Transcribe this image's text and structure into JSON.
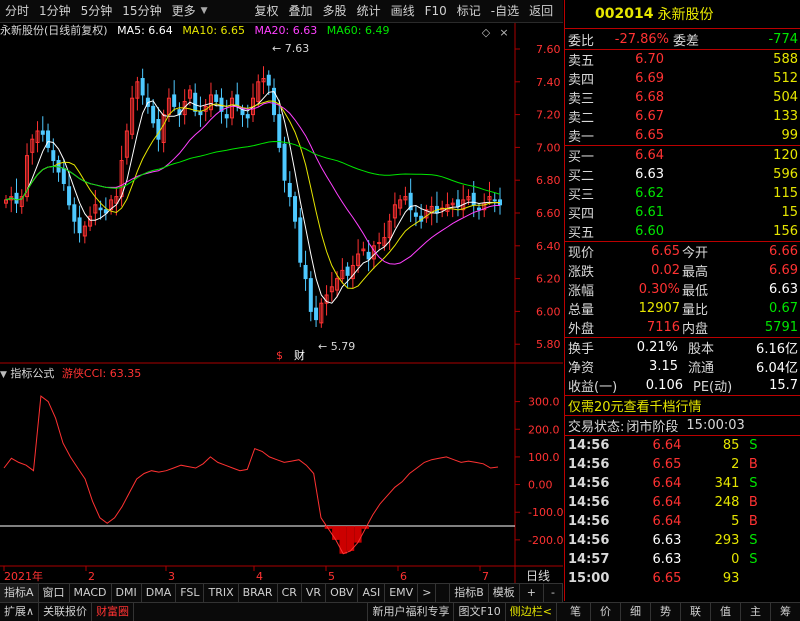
{
  "toolbar": {
    "left_items": [
      "分时",
      "1分钟",
      "5分钟",
      "15分钟",
      "更多"
    ],
    "right_items": [
      "复权",
      "叠加",
      "多股",
      "统计",
      "画线",
      "F10",
      "标记",
      "-自选",
      "返回"
    ]
  },
  "chart": {
    "title": "永新股份(日线前复权)",
    "ma": [
      {
        "label": "MA5: 6.64",
        "color": "#ffffff"
      },
      {
        "label": "MA10: 6.65",
        "color": "#e6e600"
      },
      {
        "label": "MA20: 6.63",
        "color": "#ff40ff"
      },
      {
        "label": "MA60: 6.49",
        "color": "#00e600"
      }
    ],
    "price_ticks": [
      "7.60",
      "7.40",
      "7.20",
      "7.00",
      "6.80",
      "6.60",
      "6.40",
      "6.20",
      "6.00",
      "5.80"
    ],
    "high_label": "7.63",
    "low_label": "5.79",
    "marker_s": "$",
    "marker_cai": "财",
    "x_labels": [
      "2021年",
      "2",
      "3",
      "4",
      "5",
      "6",
      "7"
    ],
    "period_label": "日线"
  },
  "indicator": {
    "title": "指标公式",
    "name": "游侠CCI: 63.35",
    "ticks": [
      "300.0",
      "200.0",
      "100.0",
      "0.00",
      "-100.0",
      "-200.0"
    ]
  },
  "chart_data": {
    "type": "line",
    "title": "游侠CCI",
    "series": [
      {
        "name": "游侠CCI",
        "values": [
          60,
          95,
          80,
          70,
          50,
          320,
          300,
          240,
          150,
          100,
          60,
          20,
          -60,
          -120,
          -140,
          -120,
          -80,
          -30,
          20,
          40,
          50,
          45,
          50,
          60,
          70,
          65,
          60,
          75,
          100,
          80,
          70,
          60,
          50,
          55,
          130,
          120,
          100,
          90,
          80,
          85,
          90,
          70,
          40,
          -120,
          -160,
          -200,
          -250,
          -240,
          -210,
          -160,
          -110,
          -70,
          -40,
          -10,
          10,
          40,
          60,
          80,
          90,
          95,
          100,
          90,
          80,
          85,
          80,
          75,
          60,
          63.35
        ]
      }
    ],
    "ylim": [
      -280,
      360
    ]
  },
  "quote": {
    "code": "002014",
    "name": "永新股份",
    "weibi_label": "委比",
    "weibi": "-27.86%",
    "weicha_label": "委差",
    "weicha": "-774",
    "asks": [
      {
        "label": "卖五",
        "price": "6.70",
        "vol": "588"
      },
      {
        "label": "卖四",
        "price": "6.69",
        "vol": "512"
      },
      {
        "label": "卖三",
        "price": "6.68",
        "vol": "504"
      },
      {
        "label": "卖二",
        "price": "6.67",
        "vol": "133"
      },
      {
        "label": "卖一",
        "price": "6.65",
        "vol": "99"
      }
    ],
    "bids": [
      {
        "label": "买一",
        "price": "6.64",
        "vol": "120",
        "pc": "red"
      },
      {
        "label": "买二",
        "price": "6.63",
        "vol": "596",
        "pc": "wht"
      },
      {
        "label": "买三",
        "price": "6.62",
        "vol": "115",
        "pc": "grn"
      },
      {
        "label": "买四",
        "price": "6.61",
        "vol": "15",
        "pc": "grn"
      },
      {
        "label": "买五",
        "price": "6.60",
        "vol": "156",
        "pc": "grn"
      }
    ],
    "stats": [
      {
        "l1": "现价",
        "v1": "6.65",
        "c1": "red",
        "l2": "今开",
        "v2": "6.66",
        "c2": "red"
      },
      {
        "l1": "涨跌",
        "v1": "0.02",
        "c1": "red",
        "l2": "最高",
        "v2": "6.69",
        "c2": "red"
      },
      {
        "l1": "涨幅",
        "v1": "0.30%",
        "c1": "red",
        "l2": "最低",
        "v2": "6.63",
        "c2": "wht"
      },
      {
        "l1": "总量",
        "v1": "12907",
        "c1": "yel",
        "l2": "量比",
        "v2": "0.67",
        "c2": "grn"
      },
      {
        "l1": "外盘",
        "v1": "7116",
        "c1": "red",
        "l2": "内盘",
        "v2": "5791",
        "c2": "grn"
      }
    ],
    "stats2": [
      {
        "l1": "换手",
        "v1": "0.21%",
        "l2": "股本",
        "v2": "6.16亿"
      },
      {
        "l1": "净资",
        "v1": "3.15",
        "l2": "流通",
        "v2": "6.04亿"
      },
      {
        "l1": "收益(一)",
        "v1": "0.106",
        "l2": "PE(动)",
        "v2": "15.7"
      }
    ],
    "promo": "仅需20元查看千档行情",
    "trade_state_label": "交易状态:",
    "trade_state": "闭市阶段",
    "trade_time": "15:00:03",
    "ticks": [
      {
        "t": "14:56",
        "p": "6.64",
        "pc": "red",
        "v": "85",
        "bs": "S"
      },
      {
        "t": "14:56",
        "p": "6.65",
        "pc": "red",
        "v": "2",
        "bs": "B"
      },
      {
        "t": "14:56",
        "p": "6.64",
        "pc": "red",
        "v": "341",
        "bs": "S"
      },
      {
        "t": "14:56",
        "p": "6.64",
        "pc": "red",
        "v": "248",
        "bs": "B"
      },
      {
        "t": "14:56",
        "p": "6.64",
        "pc": "red",
        "v": "5",
        "bs": "B"
      },
      {
        "t": "14:56",
        "p": "6.63",
        "pc": "wht",
        "v": "293",
        "bs": "S"
      },
      {
        "t": "14:57",
        "p": "6.63",
        "pc": "wht",
        "v": "0",
        "bs": "S"
      },
      {
        "t": "15:00",
        "p": "6.65",
        "pc": "red",
        "v": "93",
        "bs": ""
      }
    ]
  },
  "indicator_tabs": [
    "指标A",
    "窗口",
    "MACD",
    "DMI",
    "DMA",
    "FSL",
    "TRIX",
    "BRAR",
    "CR",
    "VR",
    "OBV",
    "ASI",
    "EMV",
    ">"
  ],
  "indicator_tabs_right": [
    "指标B",
    "模板",
    "+",
    "-"
  ],
  "bottom_left": [
    "扩展∧",
    "关联报价",
    "财富圈"
  ],
  "bottom_mid": [
    "新用户福利专享",
    "图文F10",
    "侧边栏<"
  ],
  "bottom_right": [
    "笔",
    "价",
    "细",
    "势",
    "联",
    "值",
    "主",
    "筹"
  ]
}
